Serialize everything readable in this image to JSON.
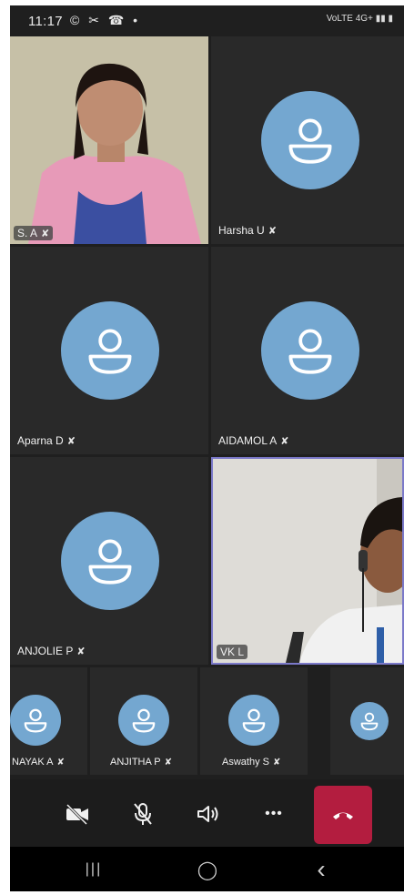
{
  "status_bar": {
    "time": "11:17",
    "left_icons": "© ✂ ☎ •",
    "right_icons": "VoLTE 4G+ ▮▮ ▮"
  },
  "participants": [
    {
      "name": "S. A",
      "video": true
    },
    {
      "name": "Harsha U",
      "video": false
    },
    {
      "name": "Aparna D",
      "video": false
    },
    {
      "name": "AIDAMOL A",
      "video": false
    },
    {
      "name": "ANJOLIE P",
      "video": false
    },
    {
      "name": "VK L",
      "video": true
    }
  ],
  "strip": [
    {
      "name": "NAYAK A"
    },
    {
      "name": "ANJITHA P"
    },
    {
      "name": "Aswathy S"
    },
    {
      "name": ""
    }
  ],
  "controls": {
    "camera_off": "camera-off-icon",
    "mute": "mic-off-icon",
    "speaker": "speaker-icon",
    "more": "•••",
    "end_call": "end-call-icon"
  },
  "nav": {
    "recents": "|||",
    "home": "◯",
    "back": "‹"
  },
  "colors": {
    "avatar": "#74a7d0",
    "tile": "#292929",
    "end_call": "#b31d3f",
    "active_border": "#7b79c9"
  }
}
